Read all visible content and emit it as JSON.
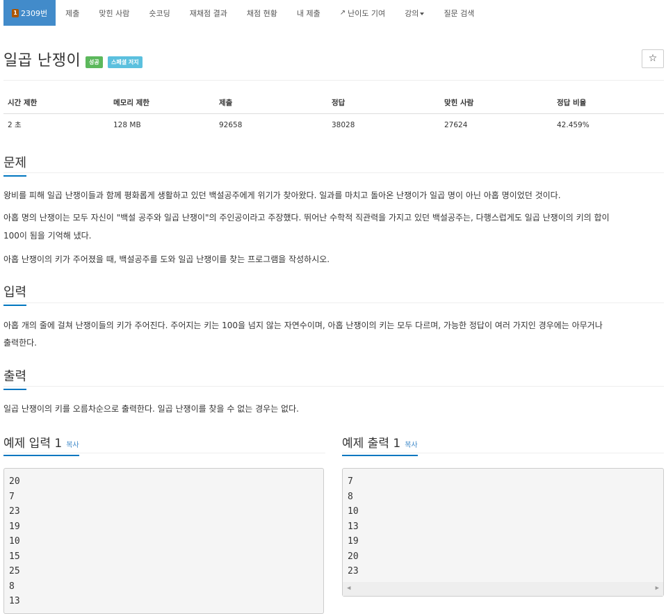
{
  "nav": {
    "problem_id": "2309번",
    "tier_label": "1",
    "tabs": [
      "제출",
      "맞힌 사람",
      "숏코딩",
      "재채점 결과",
      "채점 현황",
      "내 제출",
      "난이도 기여",
      "강의",
      "질문 검색"
    ]
  },
  "problem": {
    "title": "일곱 난쟁이",
    "badge_success": "성공",
    "badge_special": "스페셜 저지",
    "star": "☆"
  },
  "info": {
    "headers": [
      "시간 제한",
      "메모리 제한",
      "제출",
      "정답",
      "맞힌 사람",
      "정답 비율"
    ],
    "values": [
      "2 초",
      "128 MB",
      "92658",
      "38028",
      "27624",
      "42.459%"
    ]
  },
  "sections": {
    "problem_heading": "문제",
    "problem_p1": "왕비를 피해 일곱 난쟁이들과 함께 평화롭게 생활하고 있던 백설공주에게 위기가 찾아왔다. 일과를 마치고 돌아온 난쟁이가 일곱 명이 아닌 아홉 명이었던 것이다.",
    "problem_p2_line1": "아홉 명의 난쟁이는 모두 자신이 \"백설 공주와 일곱 난쟁이\"의 주인공이라고 주장했다. 뛰어난 수학적 직관력을 가지고 있던 백설공주는, 다행스럽게도 일곱 난쟁이의 키의 합이",
    "problem_p2_line2": "100이 됨을 기억해 냈다.",
    "problem_p3": "아홉 난쟁이의 키가 주어졌을 때, 백설공주를 도와 일곱 난쟁이를 찾는 프로그램을 작성하시오.",
    "input_heading": "입력",
    "input_p_line1": "아홉 개의 줄에 걸쳐 난쟁이들의 키가 주어진다. 주어지는 키는 100을 넘지 않는 자연수이며, 아홉 난쟁이의 키는 모두 다르며, 가능한 정답이 여러 가지인 경우에는 아무거나",
    "input_p_line2": "출력한다.",
    "output_heading": "출력",
    "output_p": "일곱 난쟁이의 키를 오름차순으로 출력한다. 일곱 난쟁이를 찾을 수 없는 경우는 없다."
  },
  "samples": {
    "input_heading": "예제 입력 1",
    "output_heading": "예제 출력 1",
    "copy_label": "복사",
    "input_lines": [
      "20",
      "7",
      "23",
      "19",
      "10",
      "15",
      "25",
      "8",
      "13"
    ],
    "output_lines": [
      "7",
      "8",
      "10",
      "13",
      "19",
      "20",
      "23"
    ]
  },
  "colors": {
    "nav_active": "#428bca",
    "success": "#5cb85c",
    "special": "#5bc0de",
    "section_underline": "#0076c0"
  }
}
